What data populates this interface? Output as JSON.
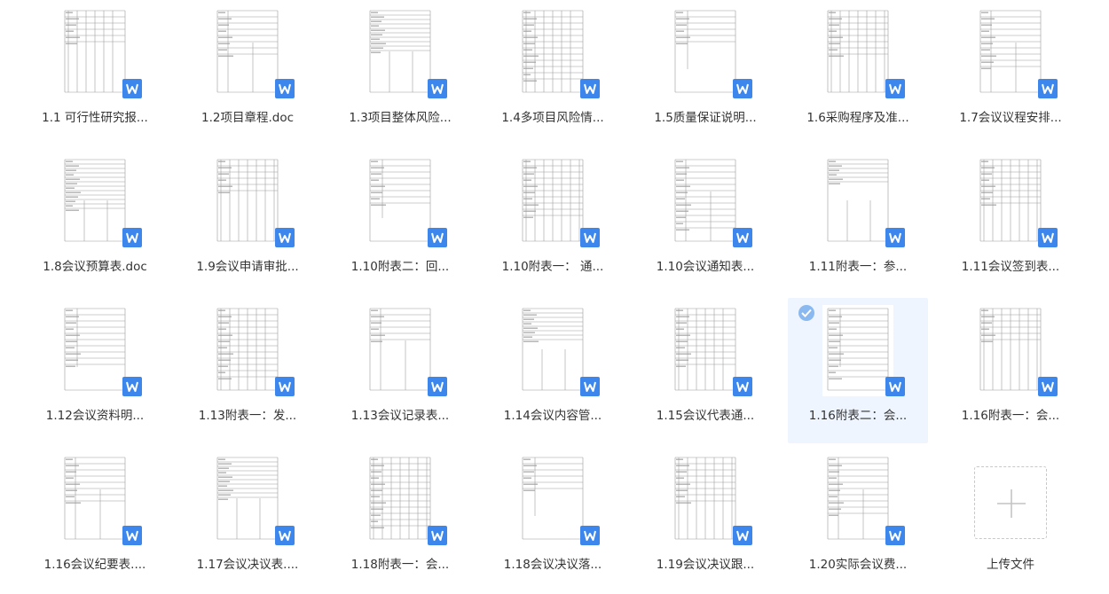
{
  "files": [
    {
      "name": "1.1 可行性研究报...",
      "selected": false
    },
    {
      "name": "1.2项目章程.doc",
      "selected": false
    },
    {
      "name": "1.3项目整体风险...",
      "selected": false
    },
    {
      "name": "1.4多项目风险情...",
      "selected": false
    },
    {
      "name": "1.5质量保证说明...",
      "selected": false
    },
    {
      "name": "1.6采购程序及准...",
      "selected": false
    },
    {
      "name": "1.7会议议程安排...",
      "selected": false
    },
    {
      "name": "1.8会议预算表.doc",
      "selected": false
    },
    {
      "name": "1.9会议申请审批...",
      "selected": false
    },
    {
      "name": "1.10附表二：回...",
      "selected": false
    },
    {
      "name": "1.10附表一： 通...",
      "selected": false
    },
    {
      "name": "1.10会议通知表...",
      "selected": false
    },
    {
      "name": "1.11附表一：参...",
      "selected": false
    },
    {
      "name": "1.11会议签到表...",
      "selected": false
    },
    {
      "name": "1.12会议资料明...",
      "selected": false
    },
    {
      "name": "1.13附表一：发...",
      "selected": false
    },
    {
      "name": "1.13会议记录表...",
      "selected": false
    },
    {
      "name": "1.14会议内容管...",
      "selected": false
    },
    {
      "name": "1.15会议代表通...",
      "selected": false
    },
    {
      "name": "1.16附表二：会...",
      "selected": true
    },
    {
      "name": "1.16附表一：会...",
      "selected": false
    },
    {
      "name": "1.16会议纪要表....",
      "selected": false
    },
    {
      "name": "1.17会议决议表....",
      "selected": false
    },
    {
      "name": "1.18附表一：会...",
      "selected": false
    },
    {
      "name": "1.18会议决议落...",
      "selected": false
    },
    {
      "name": "1.19会议决议跟...",
      "selected": false
    },
    {
      "name": "1.20实际会议费...",
      "selected": false
    }
  ],
  "upload": {
    "label": "上传文件",
    "icon": "plus-icon"
  },
  "file_icon": "word-doc-icon",
  "colors": {
    "accent": "#3d87ec",
    "selected_bg": "#eef5fe",
    "check": "#8ab8f0"
  }
}
